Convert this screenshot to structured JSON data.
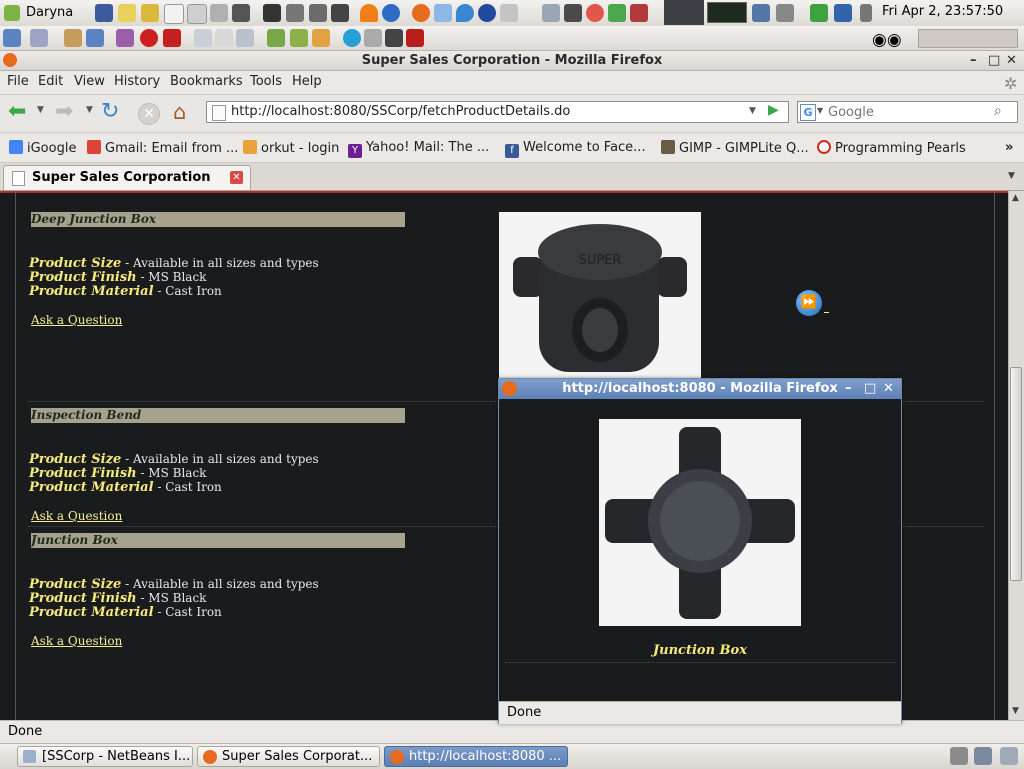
{
  "system_panel": {
    "user_label": "Daryna",
    "clock": "Fri Apr  2, 23:57:50"
  },
  "window": {
    "title": "Super Sales Corporation - Mozilla Firefox"
  },
  "menubar": {
    "items": [
      "File",
      "Edit",
      "View",
      "History",
      "Bookmarks",
      "Tools",
      "Help"
    ]
  },
  "navbar": {
    "url": "http://localhost:8080/SSCorp/fetchProductDetails.do",
    "search_placeholder": "Google"
  },
  "bookmarks": [
    {
      "label": "iGoogle",
      "icon": "google-icon",
      "color": "#4285f4"
    },
    {
      "label": "Gmail: Email from ...",
      "icon": "google-icon",
      "color": "#db4437"
    },
    {
      "label": "orkut - login",
      "icon": "google-icon",
      "color": "#e8a33d"
    },
    {
      "label": "Yahoo! Mail: The ...",
      "icon": "yahoo-icon",
      "color": "#6d1f8f"
    },
    {
      "label": "Welcome to Face...",
      "icon": "facebook-icon",
      "color": "#3b5998"
    },
    {
      "label": "GIMP - GIMPLite Q...",
      "icon": "gimp-icon",
      "color": "#6b5c4a"
    },
    {
      "label": "Programming Pearls",
      "icon": "ring-icon",
      "color": "#d12a1f"
    }
  ],
  "tabs": [
    {
      "label": "Super Sales Corporation"
    }
  ],
  "products": [
    {
      "name": "Deep Junction Box",
      "size_label": "Product Size",
      "size_value": " - Available in all sizes and types",
      "finish_label": "Product Finish",
      "finish_value": " - MS Black",
      "material_label": "Product Material",
      "material_value": " - Cast Iron",
      "ask": "Ask a Question"
    },
    {
      "name": "Inspection Bend",
      "size_label": "Product Size",
      "size_value": " - Available in all sizes and types",
      "finish_label": "Product Finish",
      "finish_value": " - MS Black",
      "material_label": "Product Material",
      "material_value": " - Cast Iron",
      "ask": "Ask a Question"
    },
    {
      "name": "Junction Box",
      "size_label": "Product Size",
      "size_value": " - Available in all sizes and types",
      "finish_label": "Product Finish",
      "finish_value": " - MS Black",
      "material_label": "Product Material",
      "material_value": " - Cast Iron",
      "ask": "Ask a Question"
    }
  ],
  "product_image_text": "SUPER",
  "status": "Done",
  "popup": {
    "title": "http://localhost:8080 - Mozilla Firefox",
    "caption": "Junction Box",
    "status": "Done"
  },
  "taskbar": [
    {
      "label": "[SSCorp - NetBeans I...",
      "icon": "netbeans-icon"
    },
    {
      "label": "Super Sales Corporat...",
      "icon": "firefox-icon"
    },
    {
      "label": "http://localhost:8080 ...",
      "icon": "firefox-icon"
    }
  ],
  "colors": {
    "page_bg": "#1a1b1d",
    "heading_bar": "#a7a28e",
    "label_yellow": "#f5eb7a",
    "popup_title": "#5d80b6"
  }
}
